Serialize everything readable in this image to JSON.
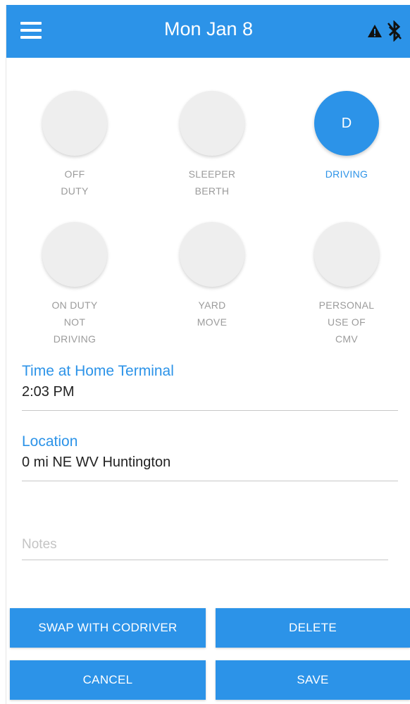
{
  "header": {
    "title": "Mon Jan 8",
    "menu_icon": "menu-icon",
    "warning_icon": "warning-icon",
    "bluetooth_icon": "bluetooth-off-icon"
  },
  "statuses": [
    {
      "label_lines": [
        "OFF",
        "DUTY"
      ],
      "code": "OFF",
      "active": false
    },
    {
      "label_lines": [
        "SLEEPER",
        "BERTH"
      ],
      "code": "SB",
      "active": false
    },
    {
      "label_lines": [
        "DRIVING"
      ],
      "code": "D",
      "active": true
    },
    {
      "label_lines": [
        "ON DUTY",
        "NOT",
        "DRIVING"
      ],
      "code": "ON",
      "active": false
    },
    {
      "label_lines": [
        "YARD",
        "MOVE"
      ],
      "code": "YM",
      "active": false
    },
    {
      "label_lines": [
        "PERSONAL",
        "USE OF",
        "CMV"
      ],
      "code": "PC",
      "active": false
    }
  ],
  "fields": {
    "time_label": "Time at Home Terminal",
    "time_value": "2:03 PM",
    "location_label": "Location",
    "location_value": "0 mi NE WV Huntington",
    "notes_placeholder": "Notes"
  },
  "buttons": {
    "swap": "SWAP WITH CODRIVER",
    "delete": "DELETE",
    "cancel": "CANCEL",
    "save": "SAVE"
  },
  "colors": {
    "accent": "#2c93e8",
    "inactive_circle": "#eeeeee",
    "inactive_text": "#9b9b9b"
  }
}
